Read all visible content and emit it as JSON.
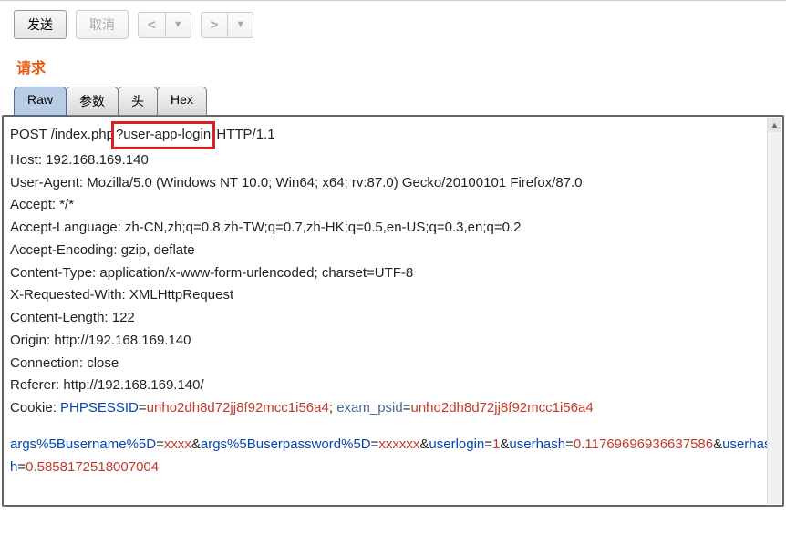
{
  "toolbar": {
    "send": "发送",
    "cancel": "取消",
    "prev": "<",
    "next": ">"
  },
  "section_title": "请求",
  "tabs": [
    "Raw",
    "参数",
    "头",
    "Hex"
  ],
  "active_tab": 0,
  "request": {
    "method": "POST",
    "path_prefix": " /index.php",
    "path_highlight": "?user-app-login",
    "path_suffix": " HTTP/1.1",
    "headers": {
      "host": "Host: 192.168.169.140",
      "ua": "User-Agent: Mozilla/5.0 (Windows NT 10.0; Win64; x64; rv:87.0) Gecko/20100101 Firefox/87.0",
      "accept": "Accept: */*",
      "accept_lang": "Accept-Language: zh-CN,zh;q=0.8,zh-TW;q=0.7,zh-HK;q=0.5,en-US;q=0.3,en;q=0.2",
      "accept_enc": "Accept-Encoding: gzip, deflate",
      "ctype": "Content-Type: application/x-www-form-urlencoded; charset=UTF-8",
      "xreq": "X-Requested-With: XMLHttpRequest",
      "clen": "Content-Length: 122",
      "origin": "Origin: http://192.168.169.140",
      "conn": "Connection: close",
      "referer": "Referer: http://192.168.169.140/"
    },
    "cookie": {
      "label": "Cookie: ",
      "k1": "PHPSESSID",
      "eq": "=",
      "v1": "unho2dh8d72jj8f92mcc1i56a4",
      "sep": "; ",
      "k2": "exam_psid",
      "v2": "unho2dh8d72jj8f92mcc1i56a4"
    },
    "body": {
      "p1k": "args%5Busername%5D",
      "eq": "=",
      "p1v": "xxxx",
      "amp": "&",
      "p2k": "args%5Buserpassword%5D",
      "p2v": "xxxxxx",
      "p3k": "userlogin",
      "p3v": "1",
      "p4k": "userhash",
      "p4v": "0.11769696936637586",
      "p5k": "userhash",
      "p5v": "0.5858172518007004"
    }
  }
}
